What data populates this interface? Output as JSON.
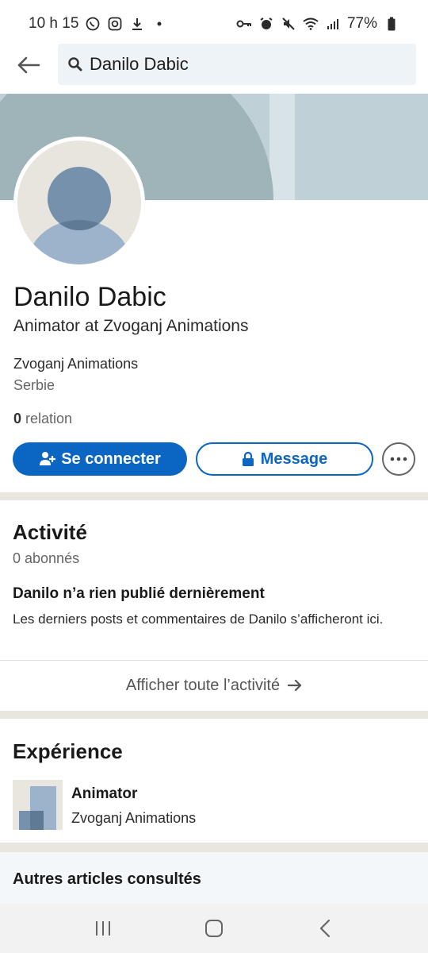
{
  "status_bar": {
    "time": "10 h 15",
    "battery": "77%"
  },
  "search": {
    "query": "Danilo Dabic"
  },
  "profile": {
    "name": "Danilo Dabic",
    "headline": "Animator at Zvoganj Animations",
    "company": "Zvoganj Animations",
    "location": "Serbie",
    "relations_count": "0",
    "relations_label": " relation"
  },
  "actions": {
    "connect_label": "Se connecter",
    "message_label": "Message"
  },
  "activity": {
    "title": "Activité",
    "followers": "0 abonnés",
    "empty_heading": "Danilo n’a rien publié dernièrement",
    "empty_desc": "Les derniers posts et commentaires de Danilo s’afficheront ici.",
    "show_all": "Afficher toute l’activité"
  },
  "experience": {
    "title": "Expérience",
    "items": [
      {
        "role": "Animator",
        "company": "Zvoganj Animations"
      }
    ]
  },
  "other": {
    "title": "Autres articles consultés"
  },
  "colors": {
    "brand_blue": "#0a66c2",
    "divider": "#e9e5df"
  }
}
